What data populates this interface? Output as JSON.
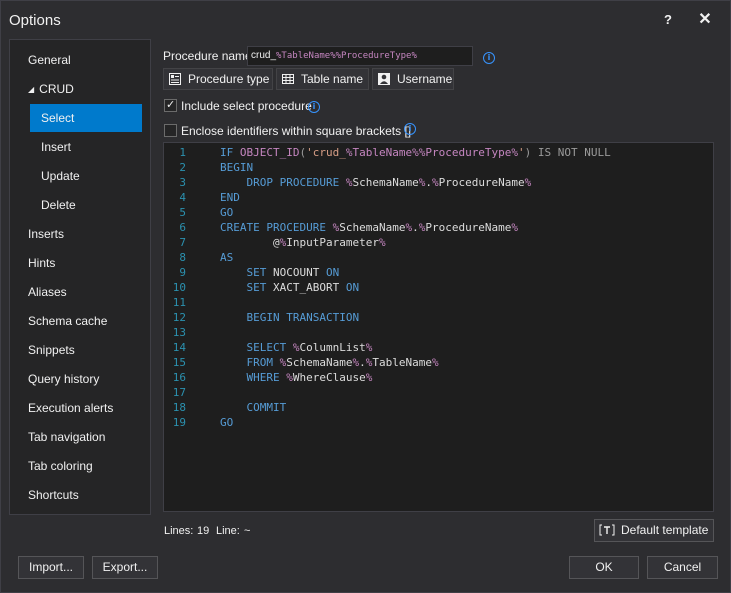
{
  "window": {
    "title": "Options",
    "help": "?",
    "close": "✕"
  },
  "sidebar": {
    "items": [
      {
        "label": "General"
      },
      {
        "label": "CRUD"
      },
      {
        "label": "Select"
      },
      {
        "label": "Insert"
      },
      {
        "label": "Update"
      },
      {
        "label": "Delete"
      },
      {
        "label": "Inserts"
      },
      {
        "label": "Hints"
      },
      {
        "label": "Aliases"
      },
      {
        "label": "Schema cache"
      },
      {
        "label": "Snippets"
      },
      {
        "label": "Query history"
      },
      {
        "label": "Execution alerts"
      },
      {
        "label": "Tab navigation"
      },
      {
        "label": "Tab coloring"
      },
      {
        "label": "Shortcuts"
      }
    ],
    "selected": "Select"
  },
  "procedure": {
    "label": "Procedure name:",
    "value_prefix": "crud_",
    "value_var": "%TableName%%ProcedureType%"
  },
  "tokens": {
    "procedure_type": "Procedure type",
    "table_name": "Table name",
    "username": "Username"
  },
  "options": {
    "include_select": {
      "label": "Include select procedure",
      "checked": true
    },
    "enclose_identifiers": {
      "label": "Enclose identifiers within square brackets []",
      "checked": false
    }
  },
  "editor": {
    "lines": [
      "IF OBJECT_ID('crud_%TableName%%ProcedureType%') IS NOT NULL",
      "BEGIN",
      "    DROP PROCEDURE %SchemaName%.%ProcedureName%",
      "END",
      "GO",
      "CREATE PROCEDURE %SchemaName%.%ProcedureName%",
      "        @%InputParameter%",
      "AS",
      "    SET NOCOUNT ON",
      "    SET XACT_ABORT ON",
      "",
      "    BEGIN TRANSACTION",
      "",
      "    SELECT %ColumnList%",
      "    FROM %SchemaName%.%TableName%",
      "    WHERE %WhereClause%",
      "",
      "    COMMIT",
      "GO"
    ]
  },
  "status": {
    "lines_label": "Lines:",
    "lines_value": "19",
    "line_label": "Line:",
    "line_value": "~"
  },
  "buttons": {
    "default_template": "Default template",
    "import": "Import...",
    "export": "Export...",
    "ok": "OK",
    "cancel": "Cancel"
  },
  "colors": {
    "accent": "#007acc",
    "background": "#2d2d30",
    "editor_bg": "#1e1e1e",
    "keyword": "#569cd6",
    "variable": "#c586c0"
  }
}
